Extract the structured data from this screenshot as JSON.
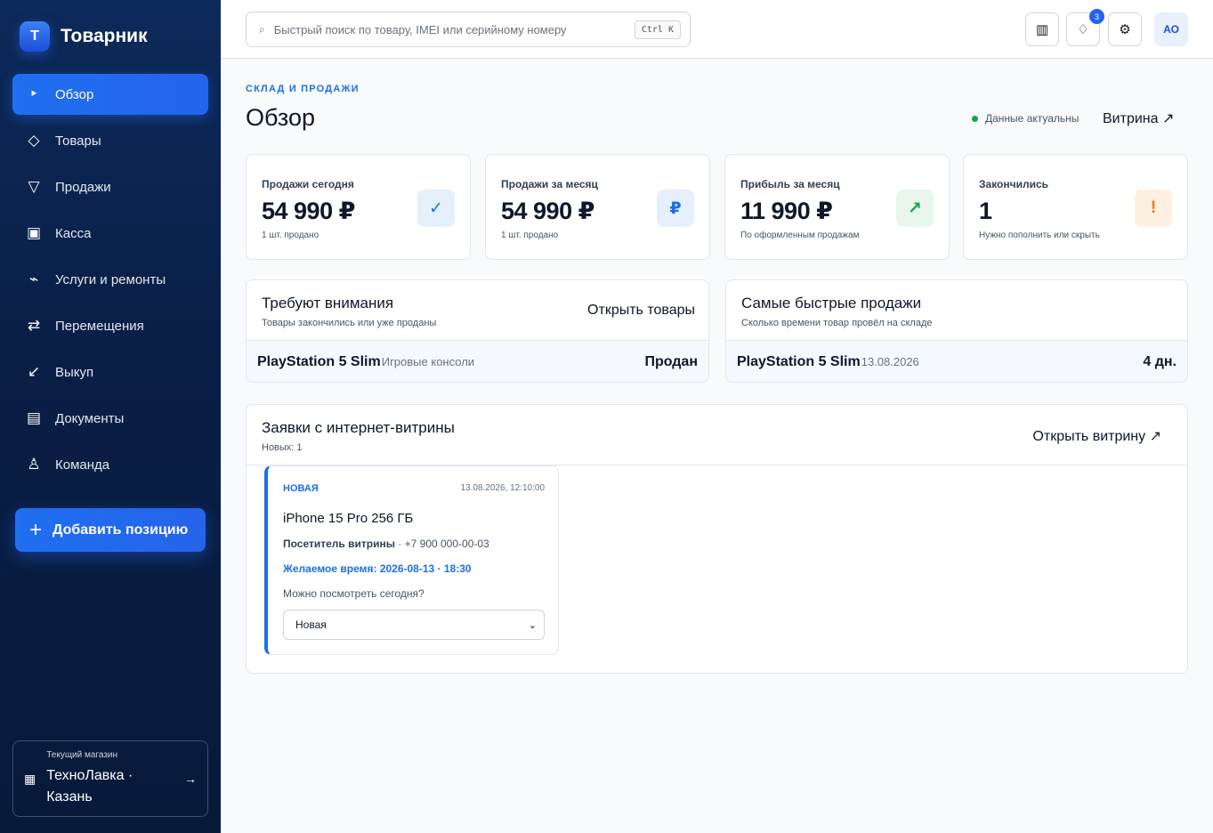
{
  "brand": {
    "logo_letter": "T",
    "name": "Товарник"
  },
  "sidebar": {
    "items": [
      {
        "label": "Обзор",
        "icon": "‣",
        "active": true
      },
      {
        "label": "Товары",
        "icon": "◇"
      },
      {
        "label": "Продажи",
        "icon": "▽"
      },
      {
        "label": "Касса",
        "icon": "▣"
      },
      {
        "label": "Услуги и ремонты",
        "icon": "⌁"
      },
      {
        "label": "Перемещения",
        "icon": "⇄"
      },
      {
        "label": "Выкуп",
        "icon": "↙"
      },
      {
        "label": "Документы",
        "icon": "▤"
      },
      {
        "label": "Команда",
        "icon": "♙"
      }
    ],
    "add_button": {
      "icon": "+",
      "label": "Добавить позицию"
    },
    "store": {
      "icon": "▦",
      "caption": "Текущий магазин",
      "name": "ТехноЛавка · Казань",
      "arrow": "→"
    }
  },
  "topbar": {
    "search": {
      "icon": "⌕",
      "placeholder": "Быстрый поиск по товару, IMEI или серийному номеру",
      "shortcut": "Ctrl K"
    },
    "grid_icon": "▥",
    "notifications_icon": "♢",
    "notifications_count": "3",
    "settings_icon": "⚙",
    "avatar": "АО"
  },
  "header": {
    "eyebrow": "СКЛАД И ПРОДАЖИ",
    "title": "Обзор",
    "status": "Данные актуальны",
    "vitrina_link": "Витрина ↗"
  },
  "stats": [
    {
      "label": "Продажи сегодня",
      "value": "54 990 ₽",
      "sub": "1 шт. продано",
      "icon": "✓",
      "icon_color": "#1d6fe0",
      "icon_bg": "#e6effc"
    },
    {
      "label": "Продажи за месяц",
      "value": "54 990 ₽",
      "sub": "1 шт. продано",
      "icon": "₽",
      "icon_color": "#1d6fe0",
      "icon_bg": "#e6effc"
    },
    {
      "label": "Прибыль за месяц",
      "value": "11 990 ₽",
      "sub": "По оформленным продажам",
      "icon": "↗",
      "icon_color": "#16a34a",
      "icon_bg": "#e8f6ec"
    },
    {
      "label": "Закончились",
      "value": "1",
      "sub": "Нужно пополнить или скрыть",
      "icon": "!",
      "icon_color": "#ea7a1a",
      "icon_bg": "#fdf0e3"
    }
  ],
  "attention": {
    "title": "Требуют внимания",
    "subtitle": "Товары закончились или уже проданы",
    "action": "Открыть товары",
    "row": {
      "name": "PlayStation 5 Slim",
      "meta": "Игровые консоли",
      "end": "Продан"
    }
  },
  "fastest": {
    "title": "Самые быстрые продажи",
    "subtitle": "Сколько времени товар провёл на складе",
    "row": {
      "name": "PlayStation 5 Slim",
      "meta": "13.08.2026",
      "end": "4 дн."
    }
  },
  "orders": {
    "title": "Заявки с интернет-витрины",
    "subtitle": "Новых: 1",
    "action": "Открыть витрину ↗",
    "card": {
      "status": "НОВАЯ",
      "date": "13.08.2026, 12:10:00",
      "title": "iPhone 15 Pro 256 ГБ",
      "customer_name": "Посетитель витрины",
      "customer_phone": " · +7 900 000-00-03",
      "preferred_time": "Желаемое время: 2026-08-13 · 18:30",
      "note": "Можно посмотреть сегодня?",
      "select_value": "Новая"
    }
  }
}
